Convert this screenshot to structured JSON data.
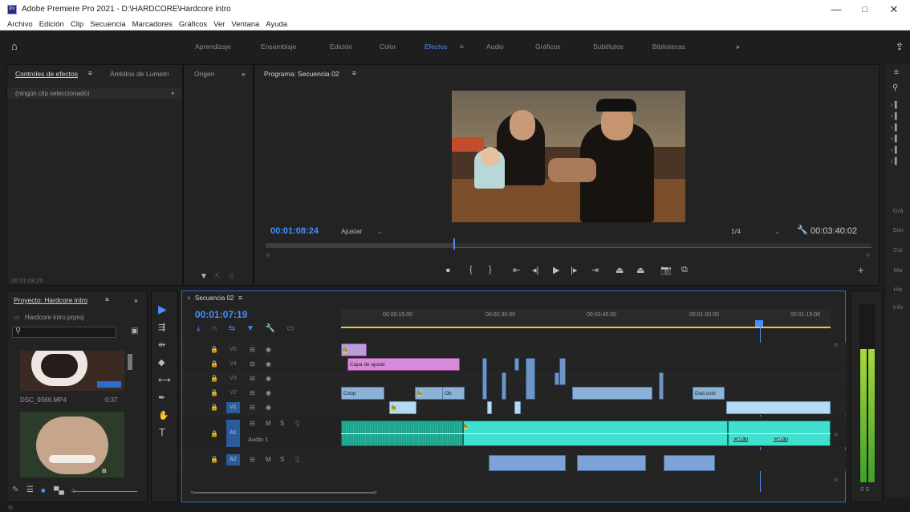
{
  "window": {
    "title": "Adobe Premiere Pro 2021 - D:\\HARDCORE\\Hardcore intro",
    "app_icon": "Pr",
    "minimize_icon": "minimize-icon",
    "maximize_icon": "maximize-icon",
    "close_icon": "close-icon"
  },
  "menu": [
    "Archivo",
    "Edición",
    "Clip",
    "Secuencia",
    "Marcadores",
    "Gráficos",
    "Ver",
    "Ventana",
    "Ayuda"
  ],
  "workspaces": [
    "Aprendizaje",
    "Ensamblaje",
    "Edición",
    "Color",
    "Efectos",
    "Audio",
    "Gráficos",
    "Subtítulos",
    "Bibliotecas",
    "»"
  ],
  "active_workspace": "Efectos",
  "effects_panel": {
    "tab1": "Controles de efectos",
    "tab2": "Ámbitos de Lumetri",
    "placeholder": "(ningún clip seleccionado)",
    "timecode": "00:01:08:20"
  },
  "source_panel": {
    "tab": "Origen",
    "more": "»"
  },
  "program_panel": {
    "tab": "Programa: Secuencia 02",
    "timecode": "00:01:08:24",
    "fit": "Ajustar",
    "resolution": "1/4",
    "duration": "00:03:40:02",
    "playhead_fraction": 0.31
  },
  "right_strip": [
    "Grá",
    "Son",
    "Col",
    "Ma",
    "His",
    "Info"
  ],
  "project_panel": {
    "tab": "Proyecto: Hardcore intro",
    "more": "»",
    "file": "Hardcore intro.prproj",
    "clip_name": "DSC_9366.MP4",
    "clip_duration": "0:37"
  },
  "timeline": {
    "tab": "Secuencia 02",
    "timecode": "00:01:07:19",
    "ruler": [
      "00:00:15:00",
      "00:00:30:00",
      "00:00:45:00",
      "00:01:00:00",
      "00:01:15:00"
    ],
    "video_tracks": [
      "V5",
      "V4",
      "V3",
      "V2",
      "V1"
    ],
    "audio_tracks": [
      "A1",
      "A2"
    ],
    "audio_track_label": "Audio 1",
    "adjustment_layer": "Capa de ajuste",
    "clip_labels": [
      "Coop",
      "Ob",
      "Dad.cool",
      "Cam 1",
      "Cam 1"
    ],
    "fx_badge": "fx",
    "track_toggles": {
      "m": "M",
      "s": "S"
    },
    "meter_solo": "S S"
  },
  "colors": {
    "accent": "#4a8cff",
    "timecode_blue": "#4a8cff",
    "video_clip": "#8cb2d8",
    "audio_clip": "#1fa08a",
    "adjustment": "#d68ad9"
  }
}
